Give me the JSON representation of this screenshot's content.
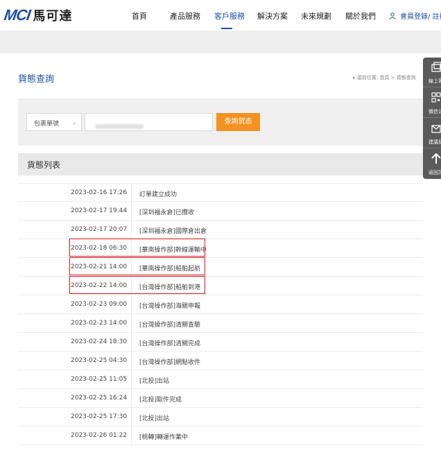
{
  "header": {
    "logo_mark": "MCI",
    "logo_text": "馬可達",
    "nav": [
      "首頁",
      "產品服務",
      "客戶服務",
      "解決方案",
      "未來規劃",
      "關於我們"
    ],
    "active_nav": "客戶服務",
    "login": "會員登錄/ 註冊"
  },
  "page": {
    "title": "貨態查詢",
    "breadcrumb": "▸ 當前位置: 首頁 > 貨態查詢"
  },
  "search": {
    "select_value": "包裹單號",
    "button_label": "查詢货态"
  },
  "list": {
    "header": "貨態列表",
    "rows": [
      {
        "time": "2023-02-16 17:26",
        "status": "訂單建立成功"
      },
      {
        "time": "2023-02-17 19:44",
        "status": "[深圳福永倉]已攬收"
      },
      {
        "time": "2023-02-17 20:07",
        "status": "[深圳福永倉]國際倉出倉"
      },
      {
        "time": "2023-02-18 06:30",
        "status": "[華南操作部]幹線運輸中"
      },
      {
        "time": "2023-02-21 14:00",
        "status": "[華南操作部]船舶起航"
      },
      {
        "time": "2023-02-22 14:00",
        "status": "[台灣操作部]船舶到港"
      },
      {
        "time": "2023-02-23 09:00",
        "status": "[台灣操作部]海關申報"
      },
      {
        "time": "2023-02-23 14:00",
        "status": "[台灣操作部]清關查驗"
      },
      {
        "time": "2023-02-24 18:30",
        "status": "[台灣操作部]清關完成"
      },
      {
        "time": "2023-02-25 04:30",
        "status": "[台灣操作部]網點收件"
      },
      {
        "time": "2023-02-25 11:05",
        "status": "[北投]出站"
      },
      {
        "time": "2023-02-25 16:24",
        "status": "[北投]取件完成"
      },
      {
        "time": "2023-02-25 17:30",
        "status": "[北投]出站"
      },
      {
        "time": "2023-02-26 01:22",
        "status": "[桃轉]轉運作業中"
      }
    ]
  },
  "sidebar": [
    {
      "label": "線上客服",
      "icon": "chat-icon"
    },
    {
      "label": "微信公众号",
      "icon": "qrcode-icon"
    },
    {
      "label": "建議反馈",
      "icon": "mail-icon"
    },
    {
      "label": "返回顶部",
      "icon": "arrow-up-icon"
    }
  ],
  "colors": {
    "brand": "#1d4fa0",
    "button": "#f39221",
    "highlight": "#d9151b"
  }
}
